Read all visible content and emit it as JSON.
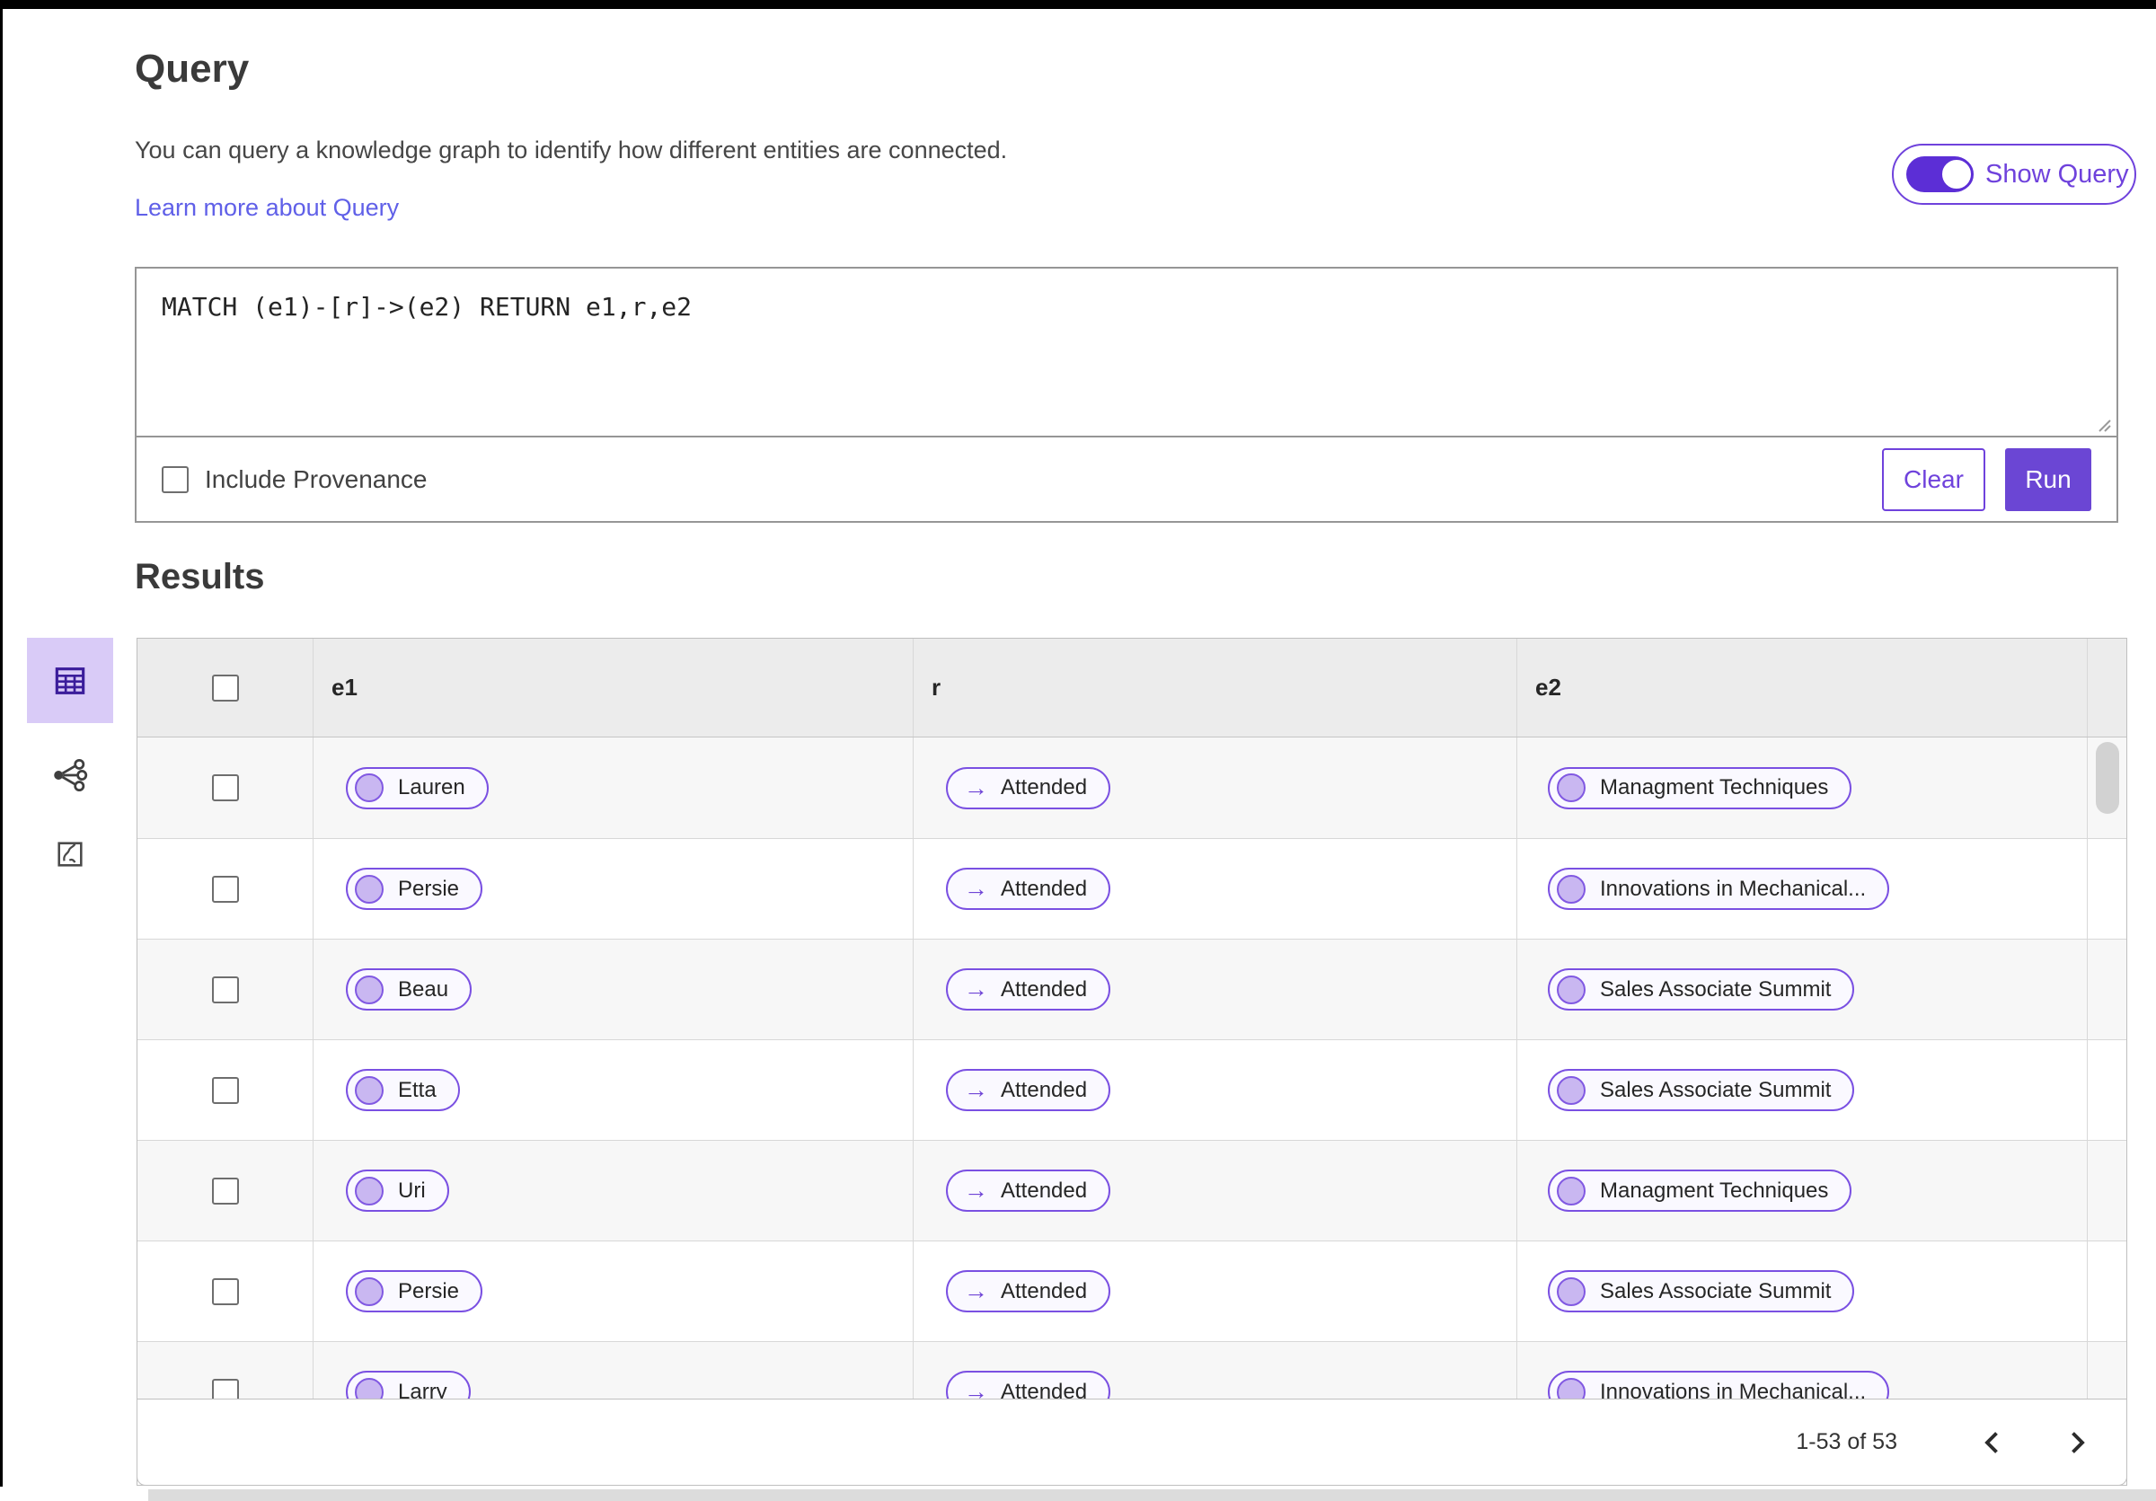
{
  "query_section": {
    "title": "Query",
    "description": "You can query a knowledge graph to identify how different entities are connected.",
    "learn_more_label": "Learn more about Query",
    "show_query": {
      "label": "Show Query",
      "state": "on"
    },
    "editor": {
      "query_text": "MATCH (e1)-[r]->(e2) RETURN e1,r,e2"
    },
    "include_provenance": {
      "label": "Include Provenance",
      "checked": false
    },
    "buttons": {
      "clear": "Clear",
      "run": "Run"
    }
  },
  "results_section": {
    "title": "Results",
    "view_switcher": [
      {
        "name": "table-view",
        "active": true
      },
      {
        "name": "graph-view",
        "active": false
      },
      {
        "name": "map-view",
        "active": false
      }
    ],
    "table": {
      "columns": [
        "e1",
        "r",
        "e2"
      ],
      "rows": [
        {
          "e1": "Lauren",
          "r": "Attended",
          "e2": "Managment Techniques"
        },
        {
          "e1": "Persie",
          "r": "Attended",
          "e2": "Innovations in Mechanical..."
        },
        {
          "e1": "Beau",
          "r": "Attended",
          "e2": "Sales Associate Summit"
        },
        {
          "e1": "Etta",
          "r": "Attended",
          "e2": "Sales Associate Summit"
        },
        {
          "e1": "Uri",
          "r": "Attended",
          "e2": "Managment Techniques"
        },
        {
          "e1": "Persie",
          "r": "Attended",
          "e2": "Sales Associate Summit"
        },
        {
          "e1": "Larry",
          "r": "Attended",
          "e2": "Innovations in Mechanical..."
        }
      ]
    },
    "pagination": {
      "label": "1-53 of 53"
    }
  },
  "colors": {
    "accent_purple": "#6f42dc",
    "toggle_purple": "#5c2ed6",
    "run_button_bg": "#6b46d4",
    "link_color": "#6060e8",
    "pill_border": "#7a50e2",
    "pill_background": "#faf9ff",
    "pill_circle": "#c9b7f1",
    "active_view_background": "#d9cbf7",
    "table_header_background": "#ececec",
    "zebra_row_background": "#f7f7f7"
  }
}
